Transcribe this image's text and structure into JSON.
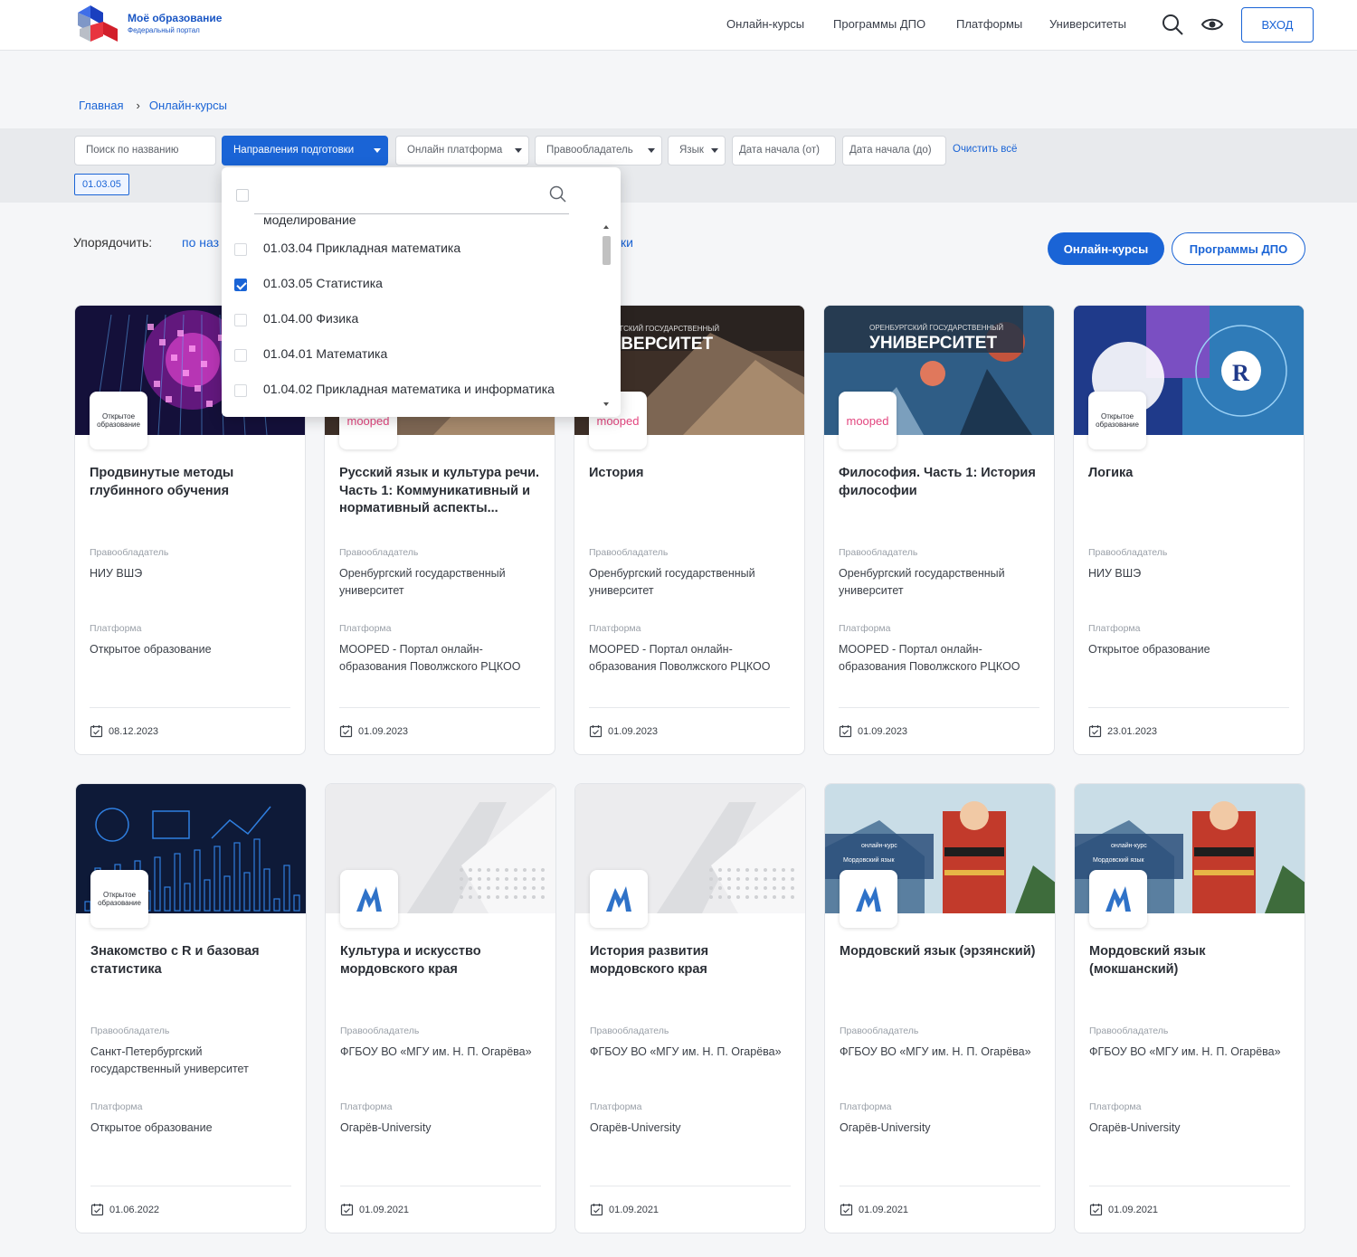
{
  "header": {
    "logo_title": "Моё образование",
    "logo_subtitle": "Федеральный портал",
    "nav": [
      "Онлайн-курсы",
      "Программы ДПО",
      "Платформы",
      "Университеты"
    ],
    "login_label": "ВХОД",
    "icons": [
      "search-icon",
      "eye-icon"
    ]
  },
  "breadcrumbs": [
    "Главная",
    "Онлайн-курсы"
  ],
  "filters": {
    "search_placeholder": "Поиск по названию",
    "directions": "Направления подготовки",
    "platform": "Онлайн платформа",
    "rightholder": "Правообладатель",
    "language": "Язык",
    "date_from": "Дата начала (от)",
    "date_to": "Дата начала (до)",
    "clear_all": "Очистить всё",
    "selected_chip": "01.03.05"
  },
  "sort": {
    "label": "Упорядочить:",
    "option_left": "по наз",
    "option_right": "ки"
  },
  "tabs": {
    "courses": "Онлайн-курсы",
    "dpo": "Программы ДПО"
  },
  "dropdown": {
    "partial_item": "моделирование",
    "items": [
      {
        "label": "01.03.04 Прикладная математика",
        "checked": false
      },
      {
        "label": "01.03.05 Статистика",
        "checked": true
      },
      {
        "label": "01.04.00 Физика",
        "checked": false
      },
      {
        "label": "01.04.01 Математика",
        "checked": false
      },
      {
        "label": "01.04.02 Прикладная математика и информатика",
        "checked": false
      }
    ]
  },
  "labels": {
    "rightholder": "Правообладатель",
    "platform": "Платформа"
  },
  "cards": [
    {
      "title": "Продвинутые методы глубинного обучения",
      "rightholder": "НИУ ВШЭ",
      "platform": "Открытое образование",
      "date": "08.12.2023",
      "badge": "Открытое образование",
      "theme": "tech"
    },
    {
      "title": "Русский язык и культура речи. Часть 1: Коммуникативный и нормативный аспекты...",
      "rightholder": "Оренбургский государственный университет",
      "platform": "МООРЕD - Портал онлайн-образования Поволжского РЦКОО",
      "date": "01.09.2023",
      "badge": "mooped",
      "theme": "brown"
    },
    {
      "title": "История",
      "rightholder": "Оренбургский государственный университет",
      "platform": "МООРЕD - Портал онлайн-образования Поволжского РЦКОО",
      "date": "01.09.2023",
      "badge": "mooped",
      "theme": "brown"
    },
    {
      "title": "Философия. Часть 1: История философии",
      "rightholder": "Оренбургский государственный университет",
      "platform": "МООРЕD - Портал онлайн-образования Поволжского РЦКОО",
      "date": "01.09.2023",
      "badge": "mooped",
      "theme": "philo"
    },
    {
      "title": "Логика",
      "rightholder": "НИУ ВШЭ",
      "platform": "Открытое образование",
      "date": "23.01.2023",
      "badge": "Открытое образование",
      "theme": "puzzle"
    },
    {
      "title": "Знакомство с R и базовая статистика",
      "rightholder": "Санкт-Петербургский государственный университет",
      "platform": "Открытое образование",
      "date": "01.06.2022",
      "badge": "Открытое образование",
      "theme": "navy"
    },
    {
      "title": "Культура и искусство мордовского края",
      "rightholder": "ФГБОУ ВО «МГУ им. Н. П. Огарёва»",
      "platform": "Огарёв-University",
      "date": "01.09.2021",
      "badge": "mgu",
      "theme": "grey"
    },
    {
      "title": "История развития мордовского края",
      "rightholder": "ФГБОУ ВО «МГУ им. Н. П. Огарёва»",
      "platform": "Огарёв-University",
      "date": "01.09.2021",
      "badge": "mgu",
      "theme": "grey"
    },
    {
      "title": "Мордовский язык (эрзянский)",
      "rightholder": "ФГБОУ ВО «МГУ им. Н. П. Огарёва»",
      "platform": "Огарёв-University",
      "date": "01.09.2021",
      "badge": "mgu",
      "theme": "folk"
    },
    {
      "title": "Мордовский язык (мокшанский)",
      "rightholder": "ФГБОУ ВО «МГУ им. Н. П. Огарёва»",
      "platform": "Огарёв-University",
      "date": "01.09.2021",
      "badge": "mgu",
      "theme": "folk2"
    }
  ]
}
